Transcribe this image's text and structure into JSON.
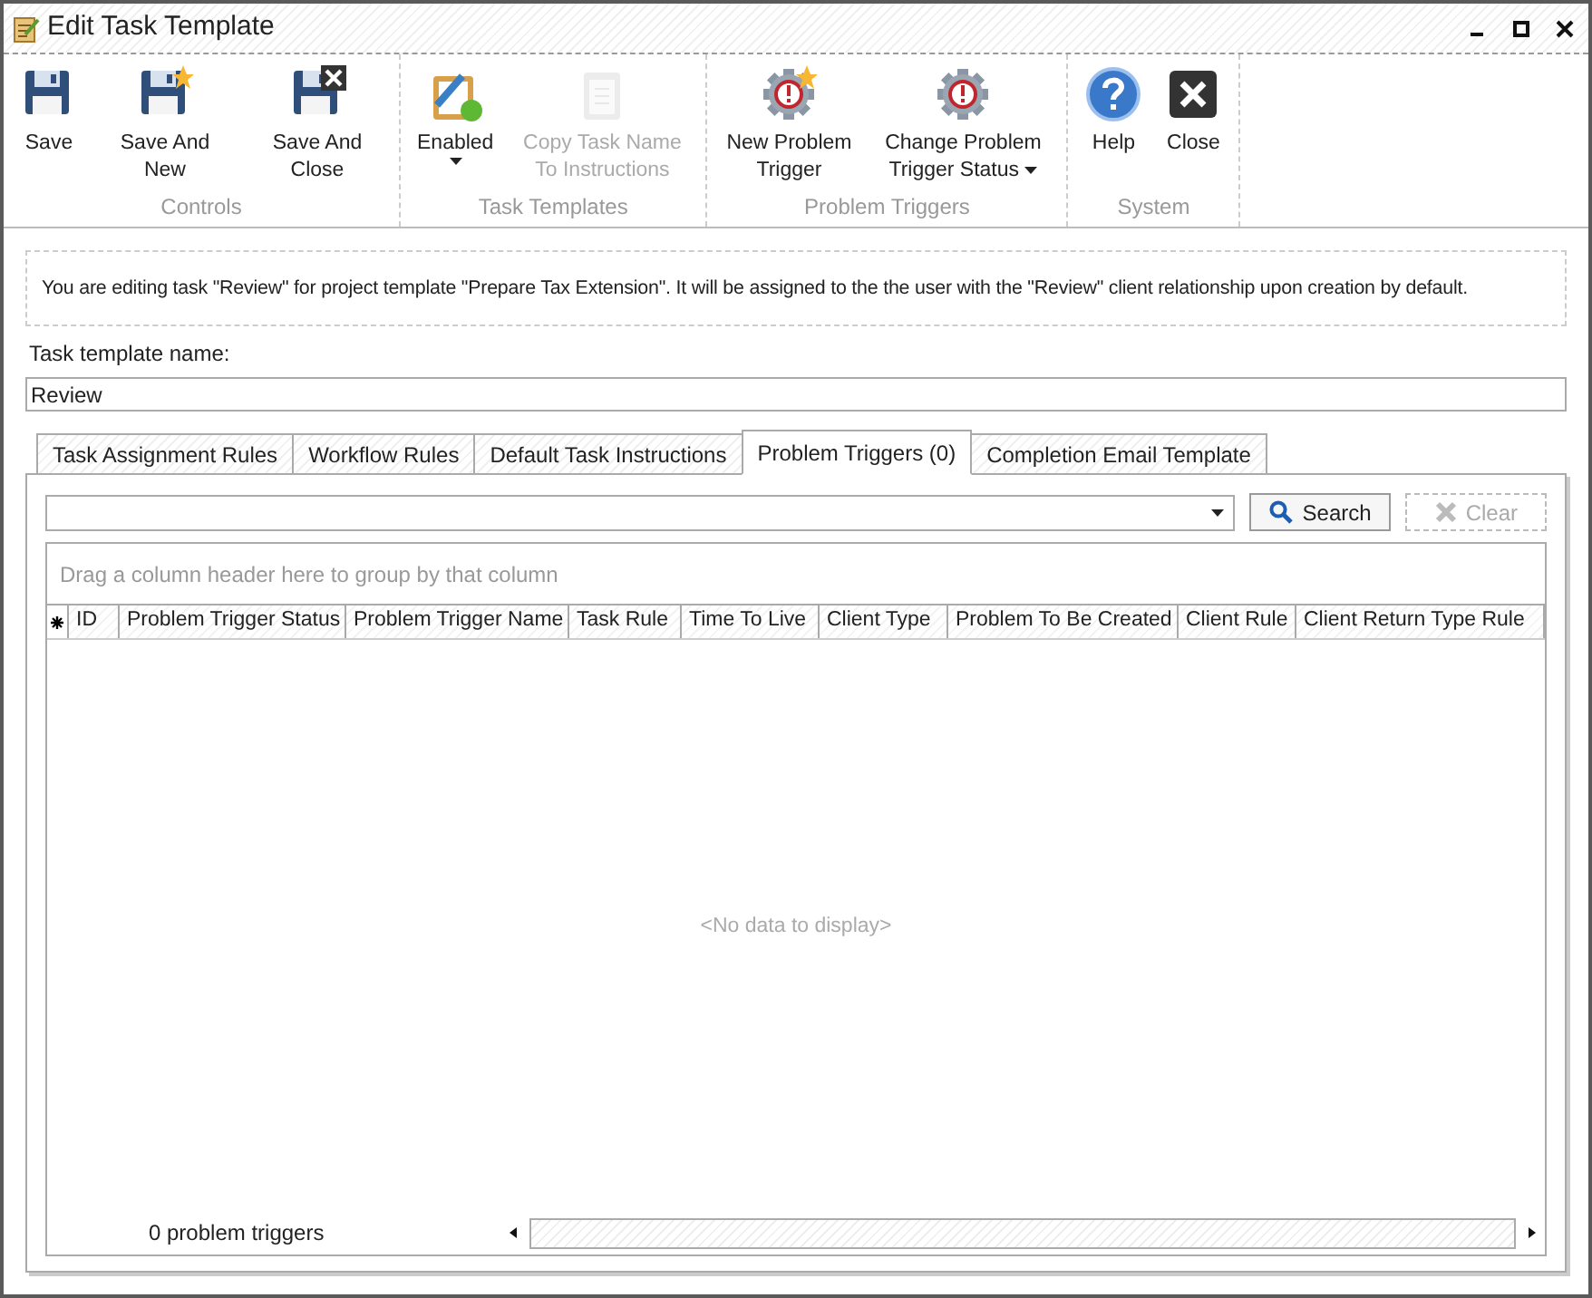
{
  "window": {
    "title": "Edit Task Template"
  },
  "ribbon": [
    {
      "label": "Controls",
      "buttons": [
        {
          "kind": "save",
          "label": "Save",
          "disabled": false,
          "dropdown": false
        },
        {
          "kind": "save-new",
          "label": "Save And New",
          "disabled": false,
          "dropdown": false
        },
        {
          "kind": "save-close",
          "label": "Save And Close",
          "disabled": false,
          "dropdown": false
        }
      ]
    },
    {
      "label": "Task Templates",
      "buttons": [
        {
          "kind": "enabled",
          "label": "Enabled",
          "disabled": false,
          "dropdown": true
        },
        {
          "kind": "copy",
          "label": "Copy Task Name To Instructions",
          "disabled": true,
          "dropdown": false
        }
      ]
    },
    {
      "label": "Problem Triggers",
      "buttons": [
        {
          "kind": "new-trigger",
          "label": "New Problem Trigger",
          "disabled": false,
          "dropdown": false
        },
        {
          "kind": "change-trigger",
          "label": "Change Problem Trigger Status",
          "disabled": false,
          "dropdown": true
        }
      ]
    },
    {
      "label": "System",
      "buttons": [
        {
          "kind": "help",
          "label": "Help",
          "disabled": false,
          "dropdown": false
        },
        {
          "kind": "close",
          "label": "Close",
          "disabled": false,
          "dropdown": false
        }
      ]
    }
  ],
  "message": "You are editing task \"Review\" for project template \"Prepare Tax Extension\". It will be assigned to the the user with the \"Review\" client relationship upon creation by default.",
  "name_field": {
    "label": "Task template name:",
    "value": "Review"
  },
  "tabs": [
    {
      "label": "Task Assignment Rules",
      "selected": false
    },
    {
      "label": "Workflow Rules",
      "selected": false
    },
    {
      "label": "Default Task Instructions",
      "selected": false
    },
    {
      "label": "Problem Triggers (0)",
      "selected": true
    },
    {
      "label": "Completion Email Template",
      "selected": false
    }
  ],
  "search_bar": {
    "search_button": "Search",
    "clear_button": "Clear",
    "clear_disabled": true
  },
  "grid": {
    "group_hint": "Drag a column header here to group by that column",
    "columns": [
      "ID",
      "Problem Trigger Status",
      "Problem Trigger Name",
      "Task Rule",
      "Time To Live",
      "Client Type",
      "Problem To Be Created",
      "Client Rule",
      "Client Return Type Rule"
    ],
    "empty_text": "<No data to display>",
    "footer": "0 problem triggers"
  }
}
